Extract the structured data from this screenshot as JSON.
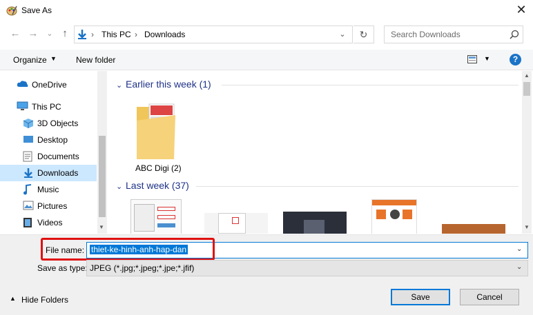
{
  "window": {
    "title": "Save As",
    "close_glyph": "✕"
  },
  "nav": {
    "back_glyph": "←",
    "forward_glyph": "→",
    "recent_glyph": "⌄",
    "up_glyph": "↑",
    "breadcrumb": [
      "This PC",
      "Downloads"
    ],
    "breadcrumb_sep": "›",
    "search_placeholder": "Search Downloads"
  },
  "toolbar": {
    "organize_label": "Organize",
    "new_folder_label": "New folder",
    "help_label": "?"
  },
  "sidebar": {
    "items": [
      {
        "label": "OneDrive",
        "icon": "cloud-icon"
      },
      {
        "label": "This PC",
        "icon": "computer-icon"
      },
      {
        "label": "3D Objects",
        "icon": "cube-icon"
      },
      {
        "label": "Desktop",
        "icon": "desktop-icon"
      },
      {
        "label": "Documents",
        "icon": "document-icon"
      },
      {
        "label": "Downloads",
        "icon": "download-icon",
        "selected": true
      },
      {
        "label": "Music",
        "icon": "music-icon"
      },
      {
        "label": "Pictures",
        "icon": "pictures-icon"
      },
      {
        "label": "Videos",
        "icon": "videos-icon"
      }
    ]
  },
  "content": {
    "groups": [
      {
        "header": "Earlier this week (1)",
        "items": [
          {
            "label": "ABC Digi (2)",
            "icon": "folder-icon"
          }
        ]
      },
      {
        "header": "Last week (37)",
        "items": []
      }
    ]
  },
  "form": {
    "file_name_label": "File name:",
    "file_name_value": "thiet-ke-hinh-anh-hap-dan",
    "save_type_label": "Save as type:",
    "save_type_value": "JPEG (*.jpg;*.jpeg;*.jpe;*.jfif)",
    "hide_folders_label": "Hide Folders",
    "save_label": "Save",
    "cancel_label": "Cancel"
  },
  "colors": {
    "accent": "#0078d7",
    "highlight_box": "#e01010",
    "selected_bg": "#cce8ff",
    "group_header": "#1e3287"
  }
}
